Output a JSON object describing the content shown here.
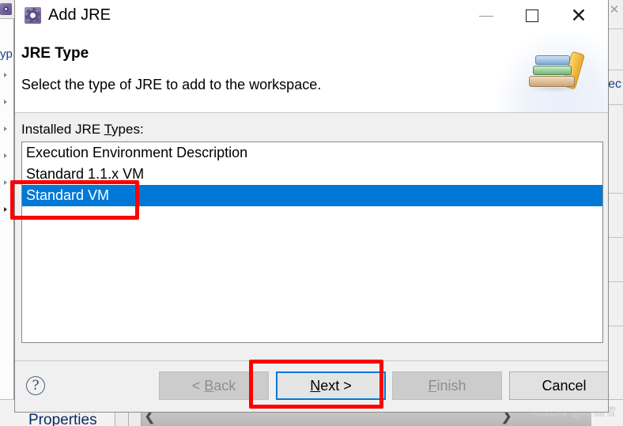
{
  "background_app": {
    "left_panel_label": "yp",
    "right_panel_text": "ec",
    "bottom_tab_label": "Properties",
    "nav_prev_icon": "chevron-left-icon",
    "nav_next_icon": "chevron-right-icon",
    "close_icon": "close-icon",
    "grid_icon": "grid-icon"
  },
  "watermark": "CSDN @沙晶雪",
  "dialog": {
    "title": "Add JRE",
    "title_icon": "gear-icon",
    "window_controls": {
      "minimize_icon": "minimize-icon",
      "maximize_icon": "maximize-icon",
      "close_icon": "close-icon",
      "minimize_label": "—",
      "maximize_label": "☐",
      "close_label": "✕"
    },
    "header": {
      "title": "JRE Type",
      "description": "Select the type of JRE to add to the workspace.",
      "banner_icon": "books-icon"
    },
    "body": {
      "list_label_prefix": "Installed JRE ",
      "list_label_mnemonic": "T",
      "list_label_suffix": "ypes:",
      "items": [
        {
          "label": "Execution Environment Description",
          "selected": false
        },
        {
          "label": "Standard 1.1.x VM",
          "selected": false
        },
        {
          "label": "Standard VM",
          "selected": true
        }
      ]
    },
    "footer": {
      "help_label": "?",
      "help_icon": "question-mark-icon",
      "buttons": [
        {
          "name": "back",
          "prefix": "< ",
          "mnemonic": "B",
          "suffix": "ack",
          "disabled": true,
          "focused": false
        },
        {
          "name": "next",
          "prefix": "",
          "mnemonic": "N",
          "suffix": "ext >",
          "disabled": false,
          "focused": true
        },
        {
          "name": "finish",
          "prefix": "",
          "mnemonic": "F",
          "suffix": "inish",
          "disabled": true,
          "focused": false
        },
        {
          "name": "cancel",
          "prefix": "",
          "mnemonic": "",
          "suffix": "Cancel",
          "disabled": false,
          "focused": false
        }
      ]
    }
  },
  "annotations": {
    "selection_highlight_color": "#ff0000",
    "focus_highlight_color": "#ff0000",
    "selection_blue": "#0078d7"
  }
}
